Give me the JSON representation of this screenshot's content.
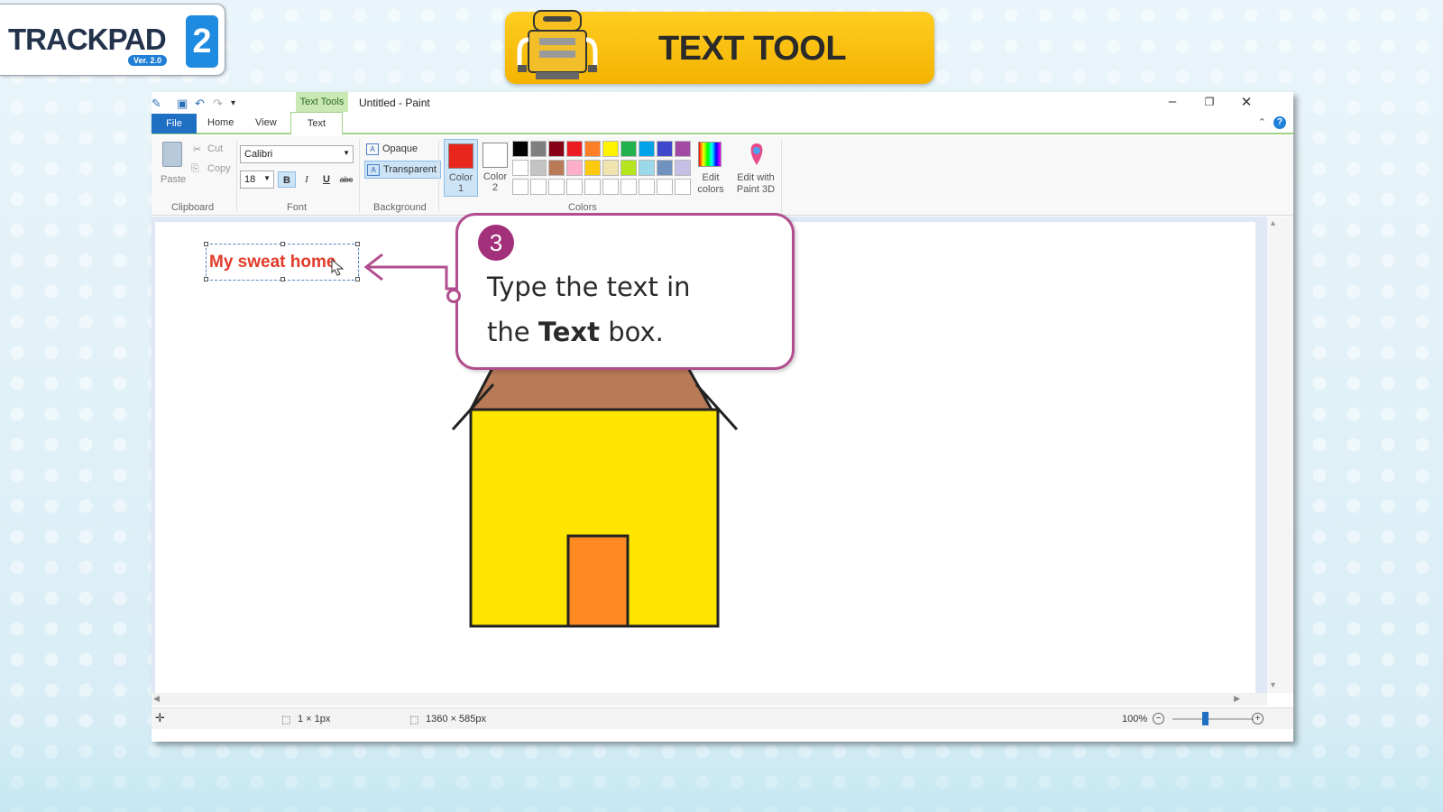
{
  "logo": {
    "word": "TRACKPAD",
    "number": "2",
    "version": "Ver. 2.0"
  },
  "banner": {
    "title": "TEXT TOOL"
  },
  "window": {
    "title": "Untitled - Paint",
    "contextual_tab": "Text Tools",
    "tabs": {
      "file": "File",
      "home": "Home",
      "view": "View",
      "text": "Text"
    },
    "help": "?"
  },
  "ribbon": {
    "clipboard": {
      "paste": "Paste",
      "cut": "Cut",
      "copy": "Copy",
      "label": "Clipboard"
    },
    "font": {
      "family": "Calibri",
      "size": "18",
      "bold": "B",
      "italic": "I",
      "underline": "U",
      "strike": "abc",
      "label": "Font"
    },
    "background": {
      "opaque": "Opaque",
      "transparent": "Transparent",
      "label": "Background"
    },
    "colors": {
      "color1_label": "Color",
      "color1_num": "1",
      "color2_label": "Color",
      "color2_num": "2",
      "color1": "#e8261c",
      "color2": "#ffffff",
      "palette_row1": [
        "#000000",
        "#7f7f7f",
        "#880015",
        "#ed1c24",
        "#ff7f27",
        "#fff200",
        "#22b14c",
        "#00a2e8",
        "#3f48cc",
        "#a349a4"
      ],
      "palette_row2": [
        "#ffffff",
        "#c3c3c3",
        "#b97a57",
        "#ffaec9",
        "#ffc90e",
        "#efe4b0",
        "#b5e61d",
        "#99d9ea",
        "#7092be",
        "#c8bfe7"
      ],
      "edit": "Edit colors",
      "edit3d": "Edit with Paint 3D",
      "label": "Colors"
    }
  },
  "canvas": {
    "text": "My sweat home"
  },
  "callout": {
    "step": "3",
    "line1": "Type the text in",
    "line2_pre": "the ",
    "line2_bold": "Text",
    "line2_post": " box."
  },
  "status": {
    "selection": "1 × 1px",
    "size": "1360 × 585px",
    "zoom": "100%"
  }
}
